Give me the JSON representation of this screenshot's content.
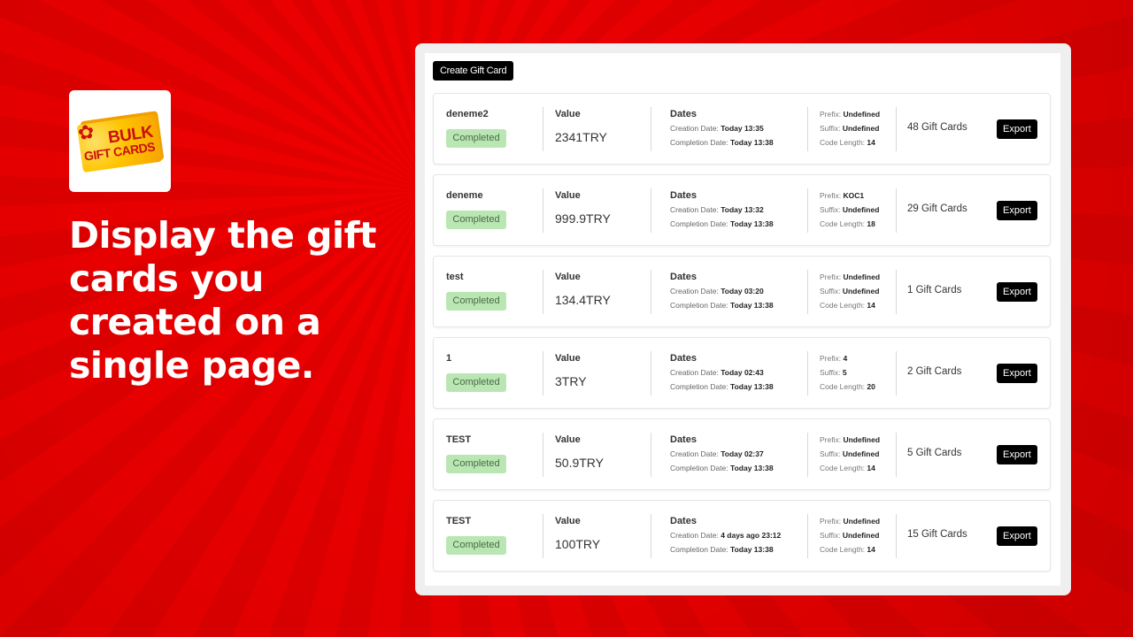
{
  "promo": {
    "logo_line1": "BULK",
    "logo_line2": "GIFT CARDS",
    "headline": "Display the gift cards you created on a single page."
  },
  "colors": {
    "background": "#e60000",
    "badge_bg": "#b9e6b3",
    "badge_text": "#4a6b47",
    "button_bg": "#000000"
  },
  "toolbar": {
    "create_label": "Create Gift Card"
  },
  "labels": {
    "value": "Value",
    "dates": "Dates",
    "creation": "Creation Date:",
    "completion": "Completion Date:",
    "prefix": "Prefix:",
    "suffix": "Suffix:",
    "code_length": "Code Length:",
    "export": "Export"
  },
  "batches": [
    {
      "name": "deneme2",
      "status": "Completed",
      "value": "2341TRY",
      "creation": "Today 13:35",
      "completion": "Today 13:38",
      "prefix": "Undefined",
      "suffix": "Undefined",
      "code_length": "14",
      "count": "48 Gift Cards"
    },
    {
      "name": "deneme",
      "status": "Completed",
      "value": "999.9TRY",
      "creation": "Today 13:32",
      "completion": "Today 13:38",
      "prefix": "KOC1",
      "suffix": "Undefined",
      "code_length": "18",
      "count": "29 Gift Cards"
    },
    {
      "name": "test",
      "status": "Completed",
      "value": "134.4TRY",
      "creation": "Today 03:20",
      "completion": "Today 13:38",
      "prefix": "Undefined",
      "suffix": "Undefined",
      "code_length": "14",
      "count": "1 Gift Cards"
    },
    {
      "name": "1",
      "status": "Completed",
      "value": "3TRY",
      "creation": "Today 02:43",
      "completion": "Today 13:38",
      "prefix": "4",
      "suffix": "5",
      "code_length": "20",
      "count": "2 Gift Cards"
    },
    {
      "name": "TEST",
      "status": "Completed",
      "value": "50.9TRY",
      "creation": "Today 02:37",
      "completion": "Today 13:38",
      "prefix": "Undefined",
      "suffix": "Undefined",
      "code_length": "14",
      "count": "5 Gift Cards"
    },
    {
      "name": "TEST",
      "status": "Completed",
      "value": "100TRY",
      "creation": "4 days ago 23:12",
      "completion": "Today 13:38",
      "prefix": "Undefined",
      "suffix": "Undefined",
      "code_length": "14",
      "count": "15 Gift Cards"
    }
  ]
}
